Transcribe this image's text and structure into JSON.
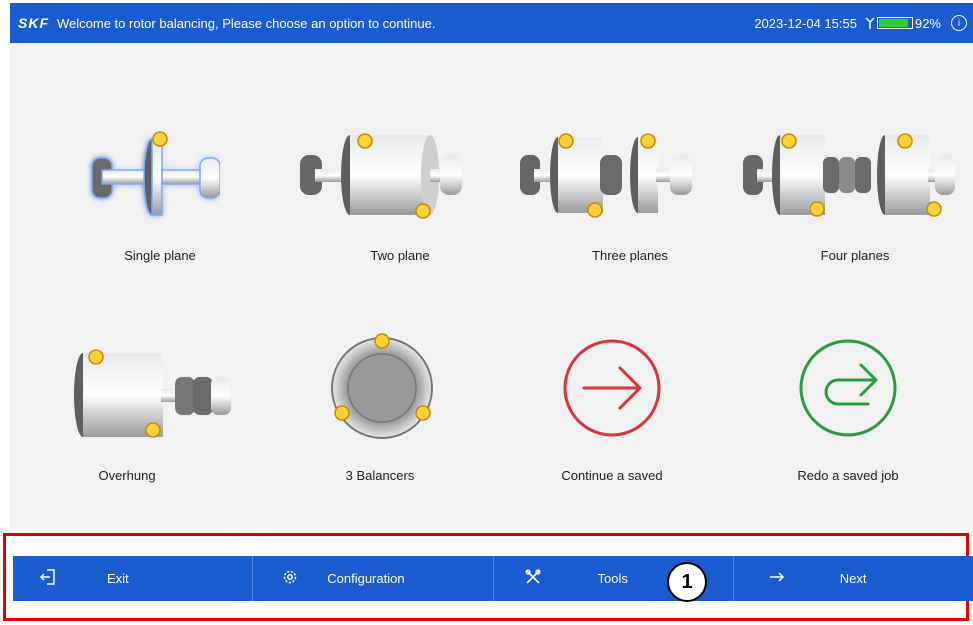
{
  "header": {
    "logo": "SKF",
    "welcome": "Welcome to rotor balancing, Please choose an option to continue.",
    "datetime": "2023-12-04 15:55",
    "battery_percent": "92%",
    "battery_level": 0.92,
    "info_glyph": "i"
  },
  "options": [
    {
      "label": "Single plane",
      "icon": "single-plane-rotor-icon"
    },
    {
      "label": "Two plane",
      "icon": "two-plane-rotor-icon"
    },
    {
      "label": "Three planes",
      "icon": "three-plane-rotor-icon"
    },
    {
      "label": "Four planes",
      "icon": "four-plane-rotor-icon"
    },
    {
      "label": "Overhung",
      "icon": "overhung-rotor-icon"
    },
    {
      "label": "3 Balancers",
      "icon": "three-balancers-icon"
    },
    {
      "label": "Continue a saved",
      "icon": "continue-arrow-icon"
    },
    {
      "label": "Redo a saved job",
      "icon": "redo-arrow-icon"
    }
  ],
  "toolbar": {
    "exit": "Exit",
    "configuration": "Configuration",
    "tools": "Tools",
    "next": "Next"
  },
  "annotation": {
    "badge": "1"
  },
  "colors": {
    "accent": "#1a5ccf",
    "background": "#f1f1f1",
    "balancer_weight": "#ffd23c",
    "continue_red": "#d9343b",
    "redo_green": "#2e9a3e",
    "highlight_frame": "#e00000"
  }
}
